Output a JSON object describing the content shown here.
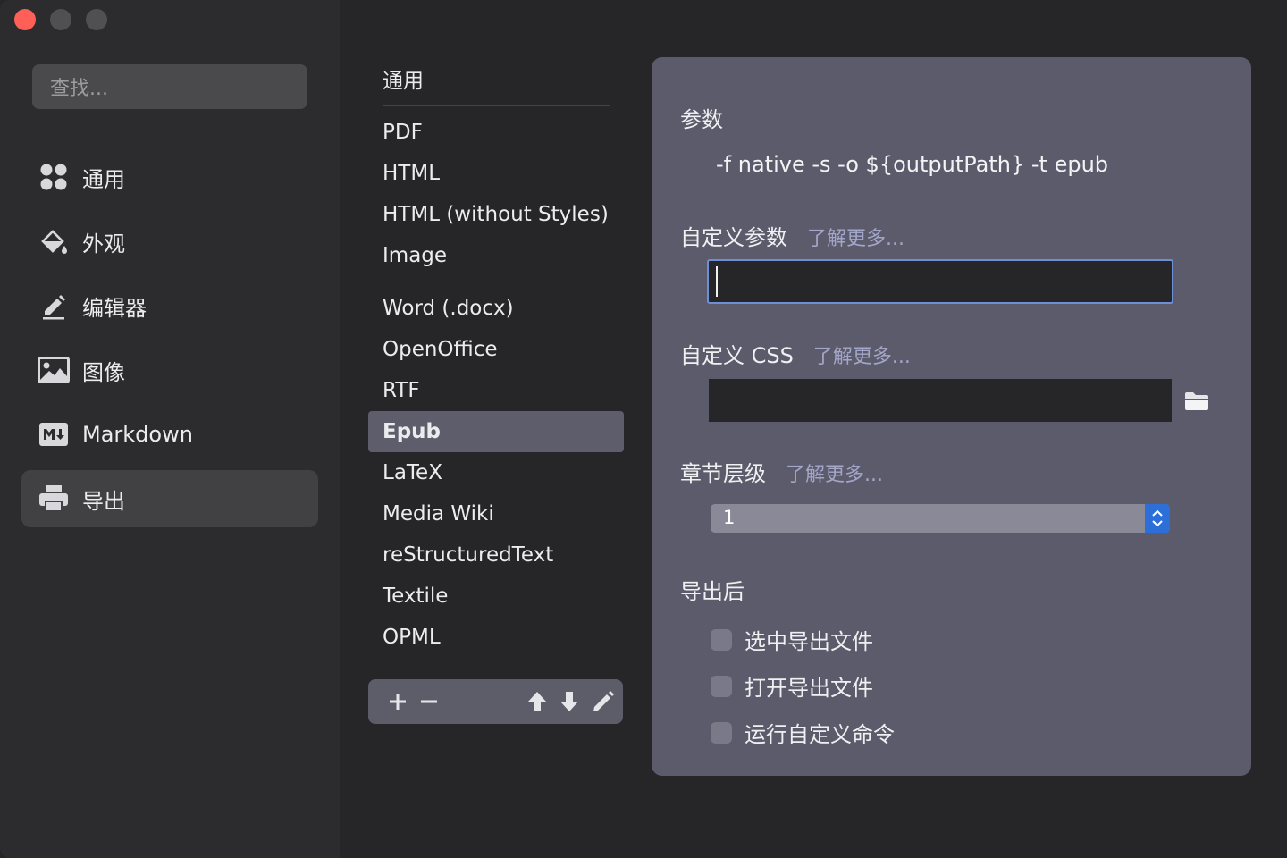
{
  "window": {
    "traffic_lights": [
      "close",
      "minimize",
      "zoom"
    ]
  },
  "sidebar": {
    "search_placeholder": "查找...",
    "items": [
      {
        "label": "通用",
        "icon": "grid-icon"
      },
      {
        "label": "外观",
        "icon": "paint-bucket-icon"
      },
      {
        "label": "编辑器",
        "icon": "pencil-icon"
      },
      {
        "label": "图像",
        "icon": "image-icon"
      },
      {
        "label": "Markdown",
        "icon": "markdown-icon"
      },
      {
        "label": "导出",
        "icon": "printer-icon",
        "active": true
      }
    ]
  },
  "export_list": {
    "header": "通用",
    "group1": [
      "PDF",
      "HTML",
      "HTML (without Styles)",
      "Image"
    ],
    "group2": [
      "Word (.docx)",
      "OpenOffice",
      "RTF",
      "Epub",
      "LaTeX",
      "Media Wiki",
      "reStructuredText",
      "Textile",
      "OPML"
    ],
    "selected": "Epub",
    "toolbar": {
      "add": "+",
      "remove": "−"
    }
  },
  "panel": {
    "params_title": "参数",
    "params_value": "-f native -s -o ${outputPath} -t epub",
    "custom_params_title": "自定义参数",
    "custom_params_value": "",
    "learn_more": "了解更多...",
    "custom_css_title": "自定义 CSS",
    "custom_css_value": "",
    "chapter_level_title": "章节层级",
    "chapter_level_value": "1",
    "after_export_title": "导出后",
    "after_export_options": [
      {
        "label": "选中导出文件",
        "checked": false
      },
      {
        "label": "打开导出文件",
        "checked": false
      },
      {
        "label": "运行自定义命令",
        "checked": false
      }
    ]
  },
  "colors": {
    "close": "#fe5f57",
    "accent": "#2d6fd9",
    "selected_row": "#5d5d6c",
    "panel": "#5c5b6b"
  }
}
